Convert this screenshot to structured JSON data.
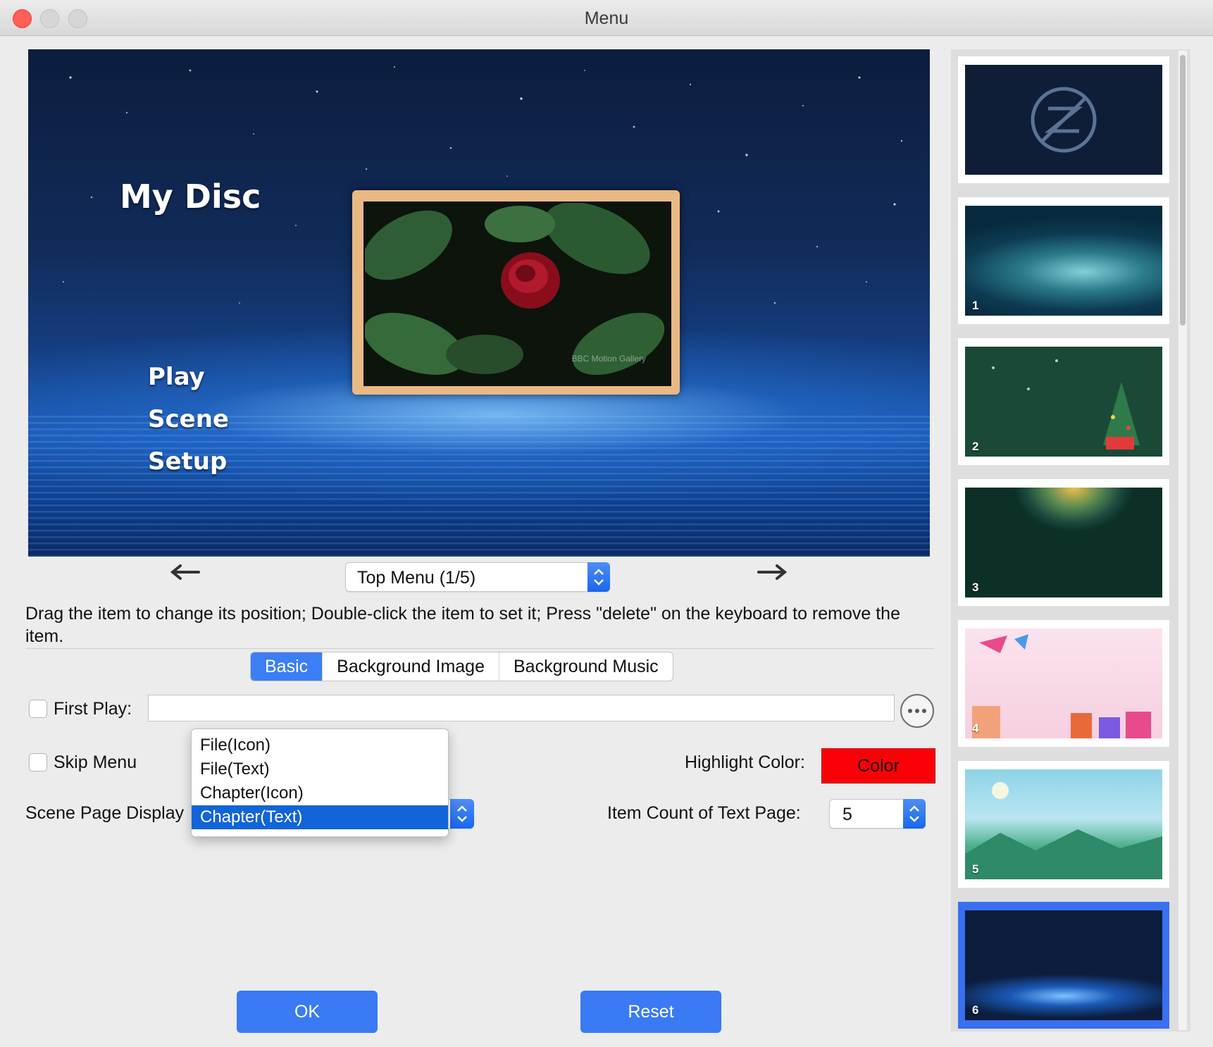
{
  "window": {
    "title": "Menu"
  },
  "preview": {
    "disc_title": "My Disc",
    "menu_items": [
      "Play",
      "Scene",
      "Setup"
    ],
    "watermark": "BBC Motion Gallery"
  },
  "navigation": {
    "menu_select": "Top Menu (1/5)"
  },
  "instruction": "Drag the item to change its position; Double-click the item to set it; Press \"delete\" on the keyboard to remove the item.",
  "tabs": [
    {
      "label": "Basic",
      "active": true
    },
    {
      "label": "Background Image",
      "active": false
    },
    {
      "label": "Background Music",
      "active": false
    }
  ],
  "basic": {
    "first_play_label": "First Play:",
    "first_play_value": "",
    "skip_menu_label": "Skip Menu",
    "highlight_color_label": "Highlight Color:",
    "highlight_color_button": "Color",
    "highlight_color": "#fb0007",
    "scene_page_display_label": "Scene Page Display",
    "scene_page_options": [
      "File(Icon)",
      "File(Text)",
      "Chapter(Icon)",
      "Chapter(Text)"
    ],
    "scene_page_selected": "Chapter(Text)",
    "item_count_label": "Item Count of Text Page:",
    "item_count_value": "5"
  },
  "buttons": {
    "ok": "OK",
    "reset": "Reset"
  },
  "templates": [
    {
      "num": "",
      "icon": "no-template-icon"
    },
    {
      "num": "1"
    },
    {
      "num": "2"
    },
    {
      "num": "3"
    },
    {
      "num": "4"
    },
    {
      "num": "5"
    },
    {
      "num": "6",
      "selected": true
    }
  ],
  "colors": {
    "accent": "#3a7af4",
    "selection": "#1264d9"
  }
}
